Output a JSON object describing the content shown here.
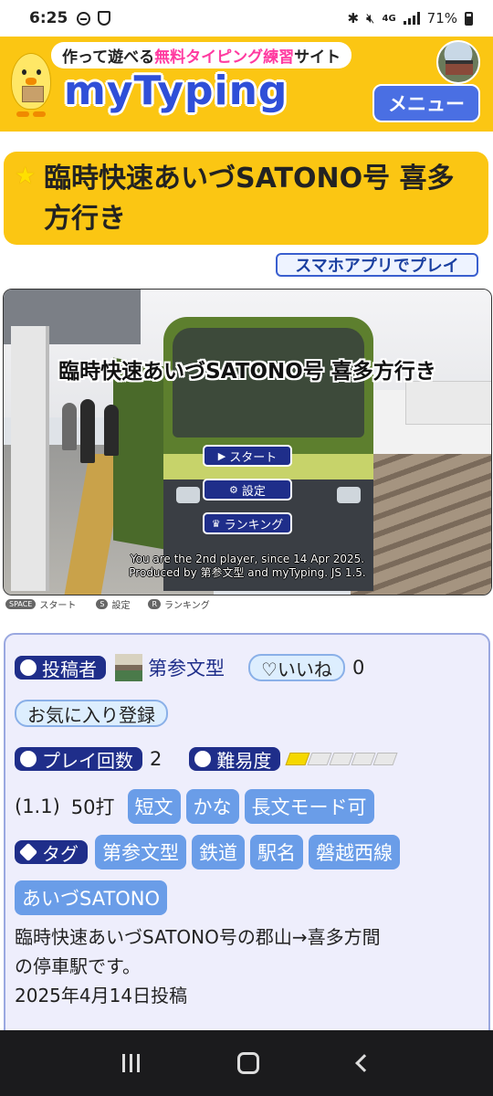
{
  "status_bar": {
    "time": "6:25",
    "network": "4G",
    "battery": "71%"
  },
  "header": {
    "tagline_pre": "作って遊べる",
    "tagline_highlight": "無料タイピング練習",
    "tagline_post": "サイト",
    "logo": "myTyping",
    "menu_label": "メニュー"
  },
  "title": "臨時快速あいづSATONO号 喜多方行き",
  "app_button": "スマホアプリでプレイ",
  "game": {
    "title": "臨時快速あいづSATONO号 喜多方行き",
    "start_label": "スタート",
    "settings_label": "設定",
    "ranking_label": "ランキング",
    "footer_line1": "You are the 2nd player, since 14 Apr 2025.",
    "footer_line2": "Produced by 第参文型 and myTyping. JS 1.5."
  },
  "shortcuts": {
    "space_key": "SPACE",
    "space_label": "スタート",
    "s_key": "S",
    "s_label": "設定",
    "r_key": "R",
    "r_label": "ランキング"
  },
  "info": {
    "poster_label": "投稿者",
    "poster_name": "第参文型",
    "like_label": "♡いいね",
    "like_count": "0",
    "favorite_label": "お気に入り登録",
    "plays_label": "プレイ回数",
    "plays_count": "2",
    "difficulty_label": "難易度",
    "difficulty_level": 1,
    "difficulty_max": 5,
    "difficulty_value": "(1.1)",
    "keystrokes": "50打",
    "attr_chips": [
      "短文",
      "かな",
      "長文モード可"
    ],
    "tag_label": "タグ",
    "tags": [
      "第参文型",
      "鉄道",
      "駅名",
      "磐越西線",
      "あいづSATONO"
    ],
    "description_line1": "臨時快速あいづSATONO号の郡山→喜多方間",
    "description_line2": "の停車駅です。",
    "posted_date": "2025年4月14日投稿"
  }
}
